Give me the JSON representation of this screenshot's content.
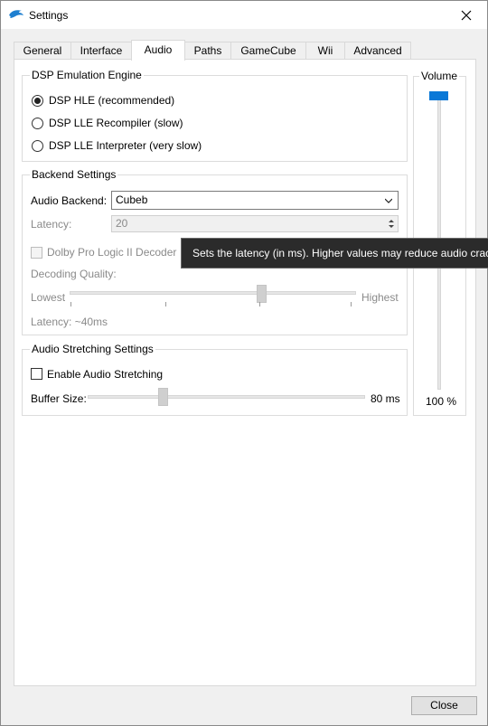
{
  "window": {
    "title": "Settings"
  },
  "tabs": [
    {
      "label": "General"
    },
    {
      "label": "Interface"
    },
    {
      "label": "Audio"
    },
    {
      "label": "Paths"
    },
    {
      "label": "GameCube"
    },
    {
      "label": "Wii"
    },
    {
      "label": "Advanced"
    }
  ],
  "active_tab": "Audio",
  "dsp": {
    "title": "DSP Emulation Engine",
    "options": [
      {
        "label": "DSP HLE (recommended)",
        "selected": true
      },
      {
        "label": "DSP LLE Recompiler (slow)",
        "selected": false
      },
      {
        "label": "DSP LLE Interpreter (very slow)",
        "selected": false
      }
    ]
  },
  "backend": {
    "title": "Backend Settings",
    "audio_backend_label": "Audio Backend:",
    "audio_backend_value": "Cubeb",
    "latency_label": "Latency:",
    "latency_value": "20",
    "dolby_label": "Dolby Pro Logic II Decoder",
    "decoding_quality_label": "Decoding Quality:",
    "quality_min_label": "Lowest",
    "quality_max_label": "Highest",
    "quality_level": 0.67,
    "latency_readout": "Latency: ~40ms"
  },
  "stretching": {
    "title": "Audio Stretching Settings",
    "enable_label": "Enable Audio Stretching",
    "enabled": false,
    "buffer_label": "Buffer Size:",
    "buffer_value": "80 ms",
    "buffer_level": 0.27
  },
  "volume": {
    "title": "Volume",
    "value": "100 %",
    "level": 1.0
  },
  "tooltip": "Sets the latency (in ms). Higher values may reduce audio crackling.",
  "close_label": "Close"
}
